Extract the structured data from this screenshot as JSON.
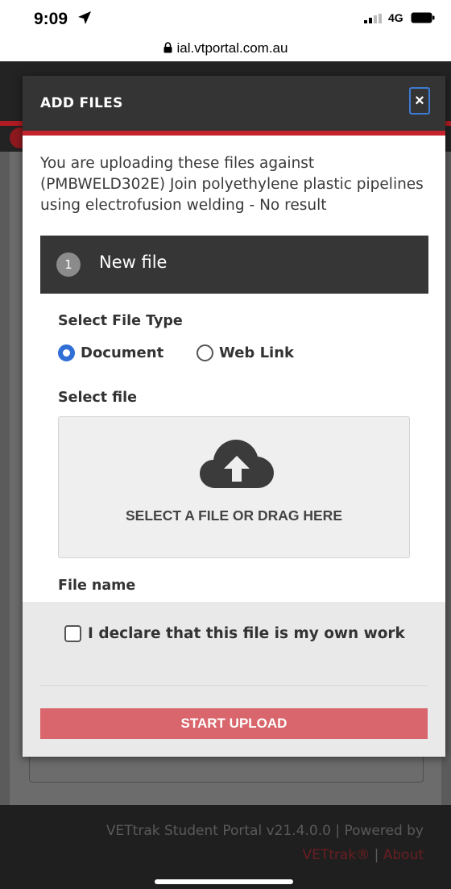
{
  "status_bar": {
    "time": "9:09",
    "network": "4G",
    "url": "ial.vtportal.com.au"
  },
  "background_page": {
    "footer_text": "VETtrak Student Portal v21.4.0.0 | Powered by",
    "footer_link_vettrak": "VETtrak®",
    "footer_separator": "|",
    "footer_link_about": "About"
  },
  "modal": {
    "title": "ADD FILES",
    "close_label": "×",
    "intro_text": "You are uploading these files against (PMBWELD302E) Join polyethylene plastic pipelines using electrofusion welding - No result",
    "step": {
      "number": "1",
      "title": "New file"
    },
    "file_type": {
      "label": "Select File Type",
      "options": [
        {
          "label": "Document",
          "selected": true
        },
        {
          "label": "Web Link",
          "selected": false
        }
      ]
    },
    "select_file_label": "Select file",
    "dropzone_text": "SELECT A FILE OR DRAG HERE",
    "file_name_label": "File name",
    "declaration_label": "I declare that this file is my own work",
    "declaration_checked": false,
    "start_upload_label": "START UPLOAD"
  },
  "colors": {
    "accent_red": "#c6242c",
    "button_red": "#d9666c",
    "radio_blue": "#2f6fd6",
    "header_dark": "#343434"
  },
  "icons": [
    "location-arrow-icon",
    "signal-icon",
    "battery-icon",
    "lock-icon",
    "close-icon",
    "cloud-upload-icon"
  ]
}
